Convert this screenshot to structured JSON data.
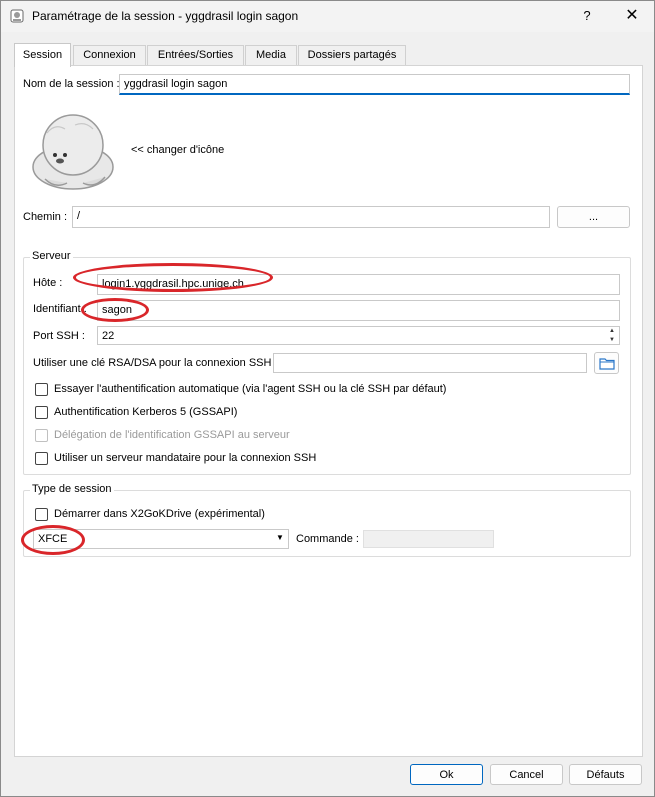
{
  "window": {
    "title": "Paramétrage de la session - yggdrasil login sagon",
    "help": "?",
    "close": "✕"
  },
  "tabs": [
    {
      "label": "Session"
    },
    {
      "label": "Connexion"
    },
    {
      "label": "Entrées/Sorties"
    },
    {
      "label": "Media"
    },
    {
      "label": "Dossiers partagés"
    }
  ],
  "session": {
    "name_label": "Nom de la session :",
    "name_value": "yggdrasil login sagon",
    "change_icon": "<< changer d'icône",
    "path_label": "Chemin :",
    "path_value": "/",
    "browse_label": "..."
  },
  "server": {
    "group_title": "Serveur",
    "host_label": "Hôte :",
    "host_value": "login1.yggdrasil.hpc.unige.ch",
    "login_label": "Identifiant :",
    "login_value": "sagon",
    "port_label": "Port SSH :",
    "port_value": "22",
    "key_label": "Utiliser une clé RSA/DSA pour la connexion SSH :",
    "key_value": "",
    "auto_auth": "Essayer l'authentification automatique (via l'agent SSH ou la clé SSH par défaut)",
    "kerberos": "Authentification Kerberos 5 (GSSAPI)",
    "delegation": "Délégation de l'identification GSSAPI au serveur",
    "proxy": "Utiliser un serveur mandataire pour la connexion SSH"
  },
  "session_type": {
    "group_title": "Type de session",
    "x2godrive": "Démarrer dans X2GoKDrive (expérimental)",
    "type_value": "XFCE",
    "command_label": "Commande :",
    "command_value": ""
  },
  "footer": {
    "ok": "Ok",
    "cancel": "Cancel",
    "defaults": "Défauts"
  },
  "colors": {
    "annotation": "#d9262a",
    "accent": "#0067c0"
  }
}
